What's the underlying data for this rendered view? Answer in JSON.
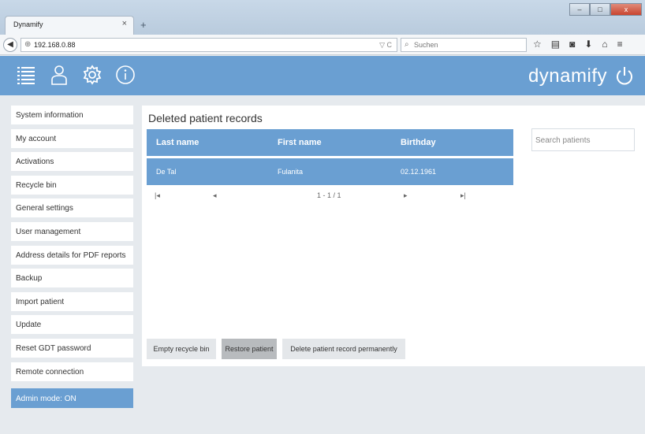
{
  "browser": {
    "tab_title": "Dynamify",
    "tab_close": "×",
    "new_tab": "+",
    "url": "192.168.0.88",
    "url_icons": "▽ C",
    "search_placeholder": "Suchen",
    "window_controls": [
      "‒",
      "□",
      "x"
    ]
  },
  "header": {
    "icons": [
      "list-icon",
      "user-icon",
      "gear-icon",
      "info-icon"
    ],
    "brand": "dynamify",
    "power_icon": "power-icon",
    "color": "#6a9fd2"
  },
  "sidebar": {
    "items": [
      {
        "label": "System information"
      },
      {
        "label": "My account"
      },
      {
        "label": "Activations"
      },
      {
        "label": "Recycle bin"
      },
      {
        "label": "General settings"
      },
      {
        "label": "User management"
      },
      {
        "label": "Address details for PDF reports"
      },
      {
        "label": "Backup"
      },
      {
        "label": "Import patient"
      },
      {
        "label": "Update"
      },
      {
        "label": "Reset GDT password"
      },
      {
        "label": "Remote connection"
      }
    ],
    "admin_mode": "Admin mode: ON"
  },
  "main": {
    "title": "Deleted patient records",
    "columns": [
      "Last name",
      "First name",
      "Birthday"
    ],
    "rows": [
      {
        "last_name": "De Tal",
        "first_name": "Fulanita",
        "birthday": "02.12.1961"
      }
    ],
    "pager": {
      "first": "|◂",
      "prev": "◂",
      "info": "1 - 1 / 1",
      "next": "▸",
      "last": "▸|"
    },
    "search_placeholder": "Search patients",
    "buttons": {
      "empty": "Empty recycle bin",
      "restore": "Restore patient",
      "delete": "Delete patient record permanently"
    }
  }
}
